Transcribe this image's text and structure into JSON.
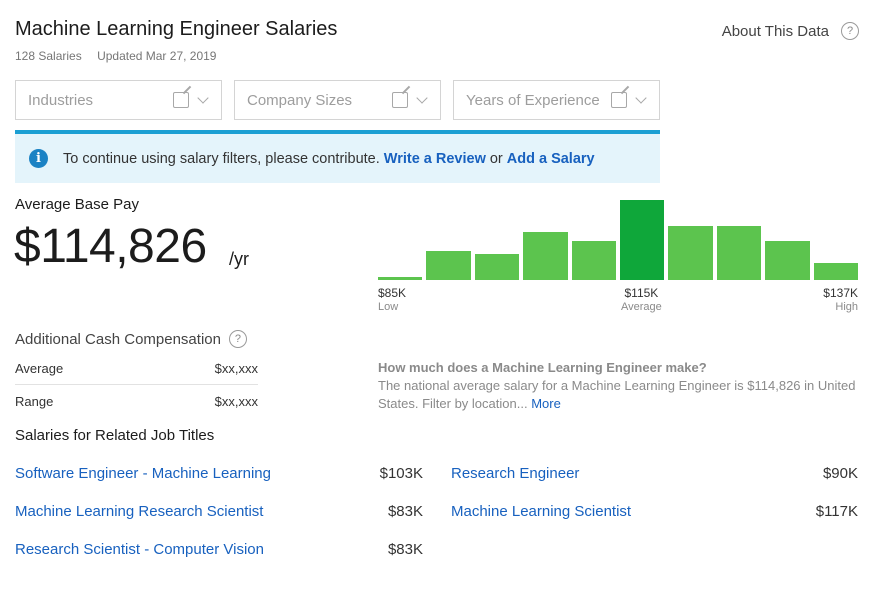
{
  "header": {
    "title": "Machine Learning Engineer Salaries",
    "salaries_count": "128 Salaries",
    "updated": "Updated Mar 27, 2019",
    "about_label": "About This Data",
    "help_icon": "?"
  },
  "filters": [
    {
      "label": "Industries"
    },
    {
      "label": "Company Sizes"
    },
    {
      "label": "Years of Experience"
    }
  ],
  "banner": {
    "info_glyph": "i",
    "text": "To continue using salary filters, please contribute.",
    "link_review": "Write a Review",
    "or_text": "or",
    "link_salary": "Add a Salary",
    "accent_color": "#1b9fd3"
  },
  "base_pay": {
    "label": "Average Base Pay",
    "value": "$114,826",
    "unit": "/yr"
  },
  "histogram": {
    "bars_relative_height": [
      0.04,
      0.36,
      0.32,
      0.6,
      0.49,
      1.0,
      0.67,
      0.67,
      0.49,
      0.21
    ],
    "highlight_index": 5,
    "bar_color": "#5cc44e",
    "highlight_color": "#0fa73a",
    "low_value": "$85K",
    "low_label": "Low",
    "avg_value": "$115K",
    "avg_label": "Average",
    "high_value": "$137K",
    "high_label": "High"
  },
  "additional_comp": {
    "title": "Additional Cash Compensation",
    "rows": [
      {
        "label": "Average",
        "value": "$xx,xxx"
      },
      {
        "label": "Range",
        "value": "$xx,xxx"
      }
    ]
  },
  "how_much": {
    "question": "How much does a Machine Learning Engineer make?",
    "answer": "The national average salary for a Machine Learning Engineer is $114,826 in United States. Filter by location...",
    "more_link": "More"
  },
  "related": {
    "title": "Salaries for Related Job Titles",
    "jobs": [
      {
        "title": "Software Engineer - Machine Learning",
        "pay": "$103K"
      },
      {
        "title": "Research Engineer",
        "pay": "$90K"
      },
      {
        "title": "Machine Learning Research Scientist",
        "pay": "$83K"
      },
      {
        "title": "Machine Learning Scientist",
        "pay": "$117K"
      },
      {
        "title": "Research Scientist - Computer Vision",
        "pay": "$83K"
      }
    ]
  }
}
